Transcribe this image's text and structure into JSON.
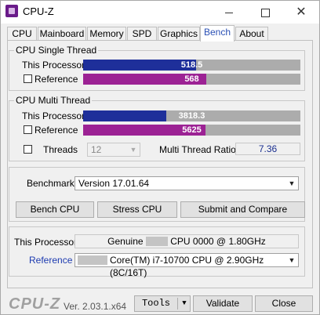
{
  "window": {
    "title": "CPU-Z",
    "minimize_glyph": "",
    "close_glyph": "✕"
  },
  "tabs": [
    {
      "label": "CPU"
    },
    {
      "label": "Mainboard"
    },
    {
      "label": "Memory"
    },
    {
      "label": "SPD"
    },
    {
      "label": "Graphics"
    },
    {
      "label": "Bench",
      "active": true
    },
    {
      "label": "About"
    }
  ],
  "single_thread": {
    "title": "CPU Single Thread",
    "this_label": "This Processor",
    "this_value": "518.5",
    "ref_label": "Reference",
    "ref_value": "568",
    "ref_checked": false
  },
  "multi_thread": {
    "title": "CPU Multi Thread",
    "this_label": "This Processor",
    "this_value": "3818.3",
    "ref_label": "Reference",
    "ref_value": "5625",
    "ref_checked": false,
    "threads_label": "Threads",
    "threads_value": "12",
    "threads_checked": false,
    "ratio_label": "Multi Thread Ratio",
    "ratio_value": "7.36"
  },
  "chart_data": {
    "type": "bar",
    "categories": [
      "Single Thread - This Processor",
      "Single Thread - Reference",
      "Multi Thread - This Processor",
      "Multi Thread - Reference"
    ],
    "values": [
      518.5,
      568,
      3818.3,
      5625
    ],
    "single_scale_max": 1000,
    "multi_scale_max": 10000,
    "colors": {
      "this": "#1e2f9a",
      "reference": "#9c2294",
      "track": "#acacac"
    }
  },
  "benchmark": {
    "label": "Benchmark",
    "version_value": "Version 17.01.64",
    "bench_cpu": "Bench CPU",
    "stress_cpu": "Stress CPU",
    "submit_compare": "Submit and Compare"
  },
  "processors": {
    "this_label": "This Processor",
    "this_prefix": "Genuine",
    "this_suffix": "CPU 0000 @ 1.80GHz",
    "ref_label": "Reference",
    "ref_value": "Core(TM) i7-10700 CPU @ 2.90GHz (8C/16T)"
  },
  "footer": {
    "logo": "CPU-Z",
    "version": "Ver. 2.03.1.x64",
    "tools": "Tools",
    "validate": "Validate",
    "close": "Close"
  }
}
